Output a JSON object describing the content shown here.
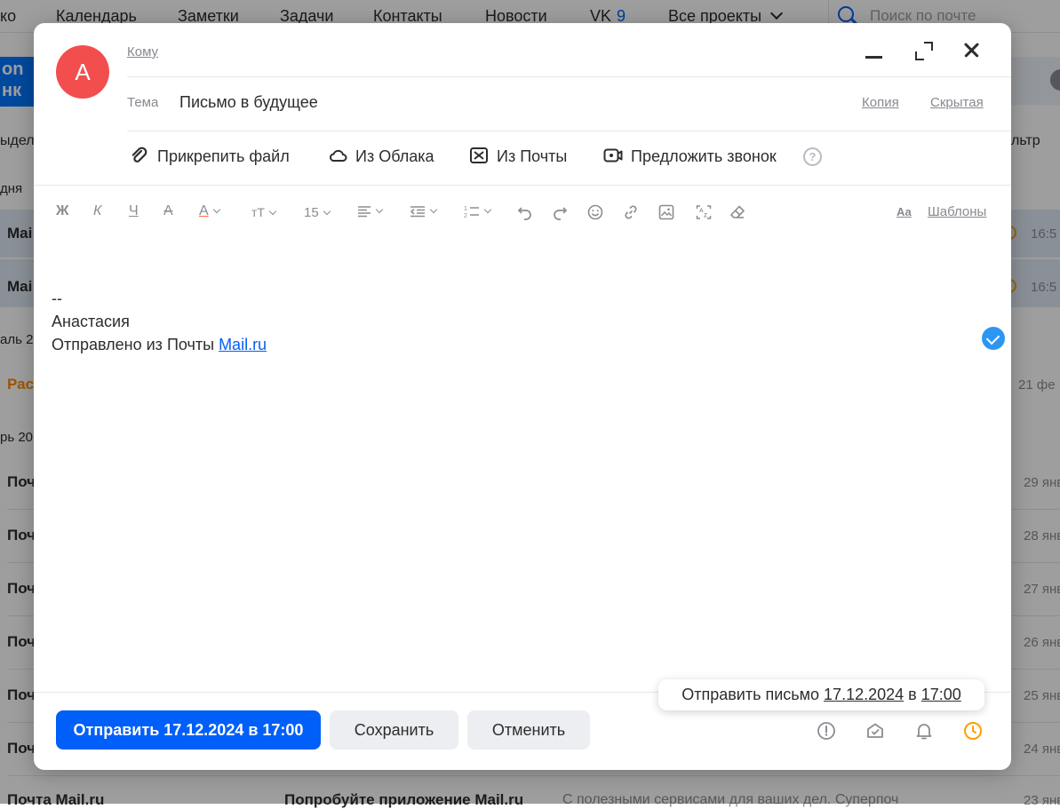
{
  "topnav": {
    "items": [
      "ко",
      "Календарь",
      "Заметки",
      "Задачи",
      "Контакты",
      "Новости",
      "VK",
      "Все проекты"
    ],
    "vk_count": "9",
    "search_placeholder": "Поиск по почте"
  },
  "background": {
    "promo_lines": [
      "on",
      "нк"
    ],
    "select_label": "ыдел",
    "filter_label": "льтр",
    "today_label": "дня",
    "rows_highlighted": [
      {
        "sender": "Mai",
        "time": "16:5"
      },
      {
        "sender": "Mai",
        "time": "16:5"
      }
    ],
    "month_label_1": "аль 2",
    "orange_row": {
      "sender": "Рас",
      "date": "21 фе"
    },
    "month_label_2": "рь 20",
    "rows": [
      {
        "sender": "Почт",
        "date": "29 янв"
      },
      {
        "sender": "Почт",
        "date": "28 янв"
      },
      {
        "sender": "Почт",
        "date": "27 янв"
      },
      {
        "sender": "Почт",
        "date": "26 янв"
      },
      {
        "sender": "Почт",
        "date": "25 янв"
      },
      {
        "sender": "Почт",
        "date": "24 янв"
      }
    ],
    "last_row": {
      "sender": "Почта Mail.ru",
      "subject": "Попробуйте приложение Mail.ru",
      "snippet": "С полезными сервисами для ваших дел. Суперпоч",
      "date": "23 янв"
    }
  },
  "compose": {
    "avatar_letter": "А",
    "avatar_color": "#f24e4e",
    "to_label": "Кому",
    "subject_label": "Тема",
    "subject_value": "Письмо в будущее",
    "cc_label": "Копия",
    "bcc_label": "Скрытая",
    "attach": {
      "file": "Прикрепить файл",
      "cloud": "Из Облака",
      "mail": "Из Почты",
      "call": "Предложить звонок"
    },
    "toolbar": {
      "bold": "Ж",
      "italic": "К",
      "underline": "Ч",
      "strike": "А",
      "font_color": "А",
      "font_size_icon": "тТ",
      "font_size_value": "15",
      "templates_icon": "Аа",
      "templates_label": "Шаблоны"
    },
    "signature": {
      "separator": "--",
      "name": "Анастасия",
      "sent_from": "Отправлено из Почты ",
      "link": "Mail.ru"
    },
    "schedule_tip": {
      "prefix": "Отправить письмо ",
      "date": "17.12.2024",
      "middle": " в ",
      "time": "17:00"
    },
    "buttons": {
      "send": "Отправить 17.12.2024 в 17:00",
      "save": "Сохранить",
      "cancel": "Отменить"
    },
    "accent_color": "#005ff9",
    "timer_color": "#ff9e00"
  }
}
